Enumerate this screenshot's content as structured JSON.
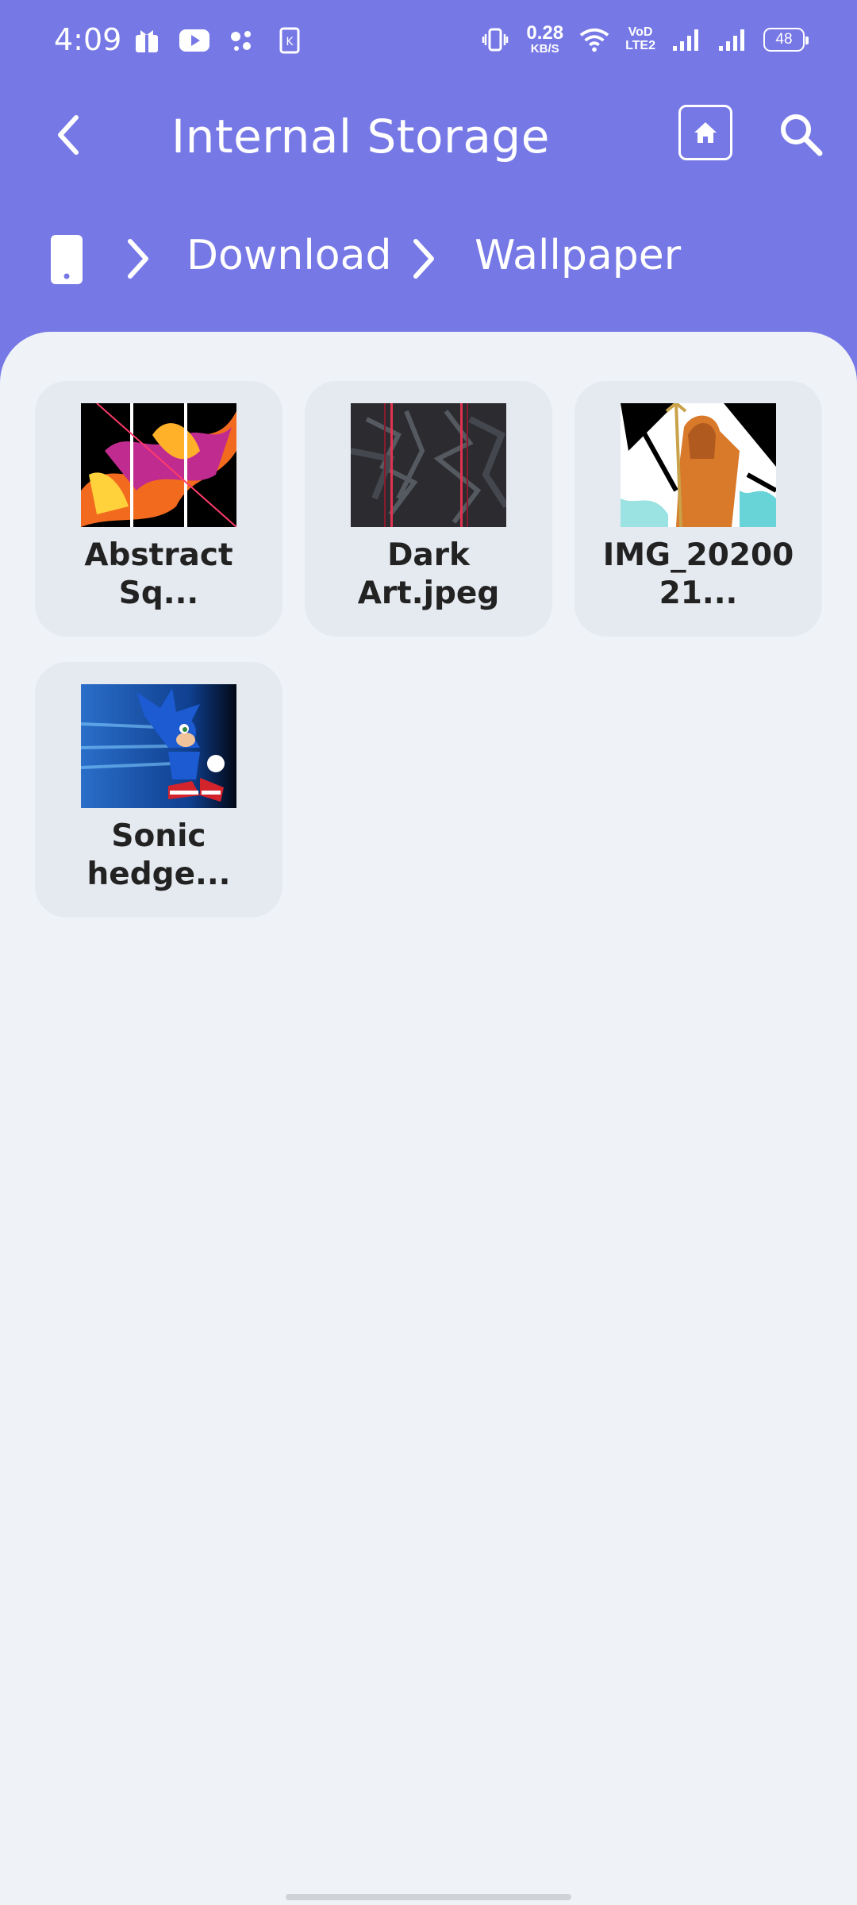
{
  "status_bar": {
    "time": "4:09",
    "net_speed_value": "0.28",
    "net_speed_unit": "KB/S",
    "volte_line1": "VoD",
    "volte_line2": "LTE2",
    "battery": "48"
  },
  "app_bar": {
    "title": "Internal Storage",
    "back_icon": "chevron-left-icon",
    "home_icon": "home-icon",
    "search_icon": "search-icon"
  },
  "breadcrumb": {
    "root_icon": "phone-icon",
    "items": [
      "Download",
      "Wallpaper"
    ]
  },
  "files": [
    {
      "line1": "Abstract",
      "line2": "Sq...",
      "thumb": "abstract"
    },
    {
      "line1": "Dark",
      "line2": "Art.jpeg",
      "thumb": "dark"
    },
    {
      "line1": "IMG_20200",
      "line2": "21...",
      "thumb": "aqua"
    },
    {
      "line1": "Sonic",
      "line2": "hedge...",
      "thumb": "sonic"
    }
  ],
  "colors": {
    "header": "#7678e6",
    "content_bg": "#eff3f7",
    "card_bg": "#e5eaf0"
  }
}
